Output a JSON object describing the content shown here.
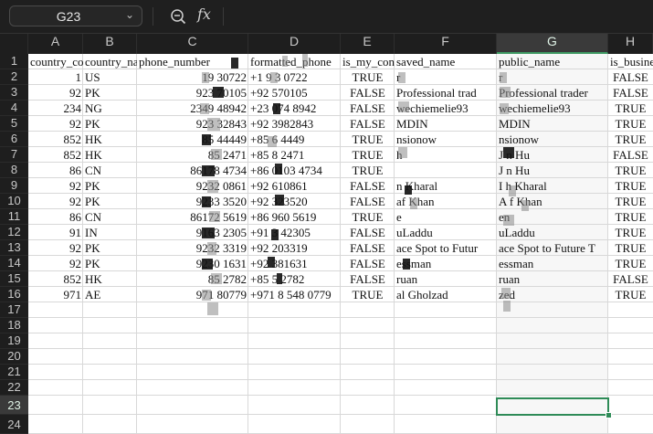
{
  "formula_bar": {
    "cell_ref": "G23",
    "fx_label": "fx",
    "formula_value": ""
  },
  "columns": [
    "A",
    "B",
    "C",
    "D",
    "E",
    "F",
    "G",
    "H"
  ],
  "selected_column": "G",
  "rows": [
    "1",
    "2",
    "3",
    "4",
    "5",
    "6",
    "7",
    "8",
    "9",
    "10",
    "11",
    "12",
    "13",
    "14",
    "15",
    "16",
    "17",
    "18",
    "19",
    "20",
    "21",
    "22",
    "23",
    "24"
  ],
  "selected_row": "23",
  "table": {
    "headers": [
      "country_co",
      "country_na",
      "phone_number",
      "formatted_phone",
      "is_my_cont",
      "saved_name",
      "public_name",
      "is_busine"
    ],
    "body": [
      [
        "1",
        "US",
        "19    30722",
        "+1 9     3 0722",
        "TRUE",
        "    r",
        "    r",
        "FALSE"
      ],
      [
        "92",
        "PK",
        "923    70105",
        "+92      570105",
        "FALSE",
        "   Professional trad",
        "   Professional trader",
        "FALSE"
      ],
      [
        "234",
        "NG",
        "2349    48942",
        "+23     074 8942",
        "FALSE",
        "   wechiemelie93",
        "   wechiemelie93",
        "TRUE"
      ],
      [
        "92",
        "PK",
        "923    32843",
        "+92      3982843",
        "FALSE",
        "   MDIN",
        "   MDIN",
        "TRUE"
      ],
      [
        "852",
        "HK",
        "85    44449",
        "+85      6 4449",
        "TRUE",
        "   nsionow",
        "   nsionow",
        "TRUE"
      ],
      [
        "852",
        "HK",
        "85    2471",
        "+85      8 2471",
        "TRUE",
        "    h",
        "J    n Hu",
        "FALSE"
      ],
      [
        "86",
        "CN",
        "86178    4734",
        "+86     0103 4734",
        "TRUE",
        "",
        "J    n Hu",
        "TRUE"
      ],
      [
        "92",
        "PK",
        "9232    0861",
        "+92      610861",
        "FALSE",
        "    n Kharal",
        "I    h Kharal",
        "TRUE"
      ],
      [
        "92",
        "PK",
        "9233    3520",
        "+92      323520",
        "FALSE",
        "    af Khan",
        "A    f Khan",
        "TRUE"
      ],
      [
        "86",
        "CN",
        "86172    5619",
        "+86     960 5619",
        "TRUE",
        "    e",
        "    en",
        "TRUE"
      ],
      [
        "91",
        "IN",
        "9163    2305",
        "+91      3 42305",
        "FALSE",
        "    uLaddu",
        "    uLaddu",
        "TRUE"
      ],
      [
        "92",
        "PK",
        "9232    3319",
        "+92      203319",
        "FALSE",
        "    ace Spot to Futur",
        "    ace Spot to Future T",
        "TRUE"
      ],
      [
        "92",
        "PK",
        "9230    1631",
        "+92      381631",
        "FALSE",
        "    essman",
        "    essman",
        "TRUE"
      ],
      [
        "852",
        "HK",
        "85    2782",
        "+85     5 2782",
        "FALSE",
        "    ruan",
        "    ruan",
        "FALSE"
      ],
      [
        "971",
        "AE",
        "971    80779",
        "+971 8 548 0779",
        "TRUE",
        "    al Gholzad",
        "    zed",
        "TRUE"
      ]
    ]
  }
}
